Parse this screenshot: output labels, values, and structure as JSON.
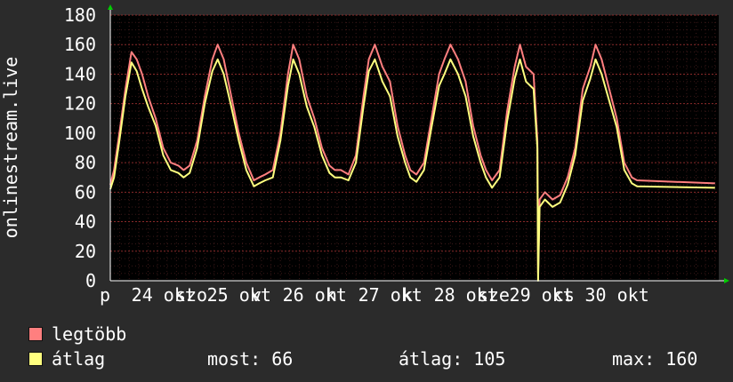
{
  "chart_data": {
    "type": "line",
    "ylabel": "onlinestream.live",
    "ylim": [
      0,
      180
    ],
    "yticks": [
      0,
      20,
      40,
      60,
      80,
      100,
      120,
      140,
      160,
      180
    ],
    "xlim": [
      0,
      8.05
    ],
    "xtick_labels": [
      {
        "x": 0.0,
        "label": "p"
      },
      {
        "x": 0.42,
        "label": "24 okt"
      },
      {
        "x": 1.0,
        "label": "szo"
      },
      {
        "x": 1.42,
        "label": "25 okt"
      },
      {
        "x": 2.0,
        "label": "v"
      },
      {
        "x": 2.42,
        "label": "26 okt"
      },
      {
        "x": 3.0,
        "label": "h"
      },
      {
        "x": 3.42,
        "label": "27 okt"
      },
      {
        "x": 4.0,
        "label": "k"
      },
      {
        "x": 4.42,
        "label": "28 okt"
      },
      {
        "x": 5.0,
        "label": "sze"
      },
      {
        "x": 5.42,
        "label": "29 okt"
      },
      {
        "x": 6.0,
        "label": "cs"
      },
      {
        "x": 6.42,
        "label": "30 okt"
      }
    ],
    "grid": true,
    "colors": {
      "max": "#ff7f7f",
      "avg": "#ffff7f",
      "background": "#000000",
      "grid": "#8a2a2a",
      "axis_arrow": "#00cc00"
    },
    "series": [
      {
        "name": "legtöbb",
        "x": [
          0,
          0.05,
          0.12,
          0.2,
          0.28,
          0.35,
          0.42,
          0.5,
          0.6,
          0.7,
          0.8,
          0.9,
          0.97,
          1.05,
          1.15,
          1.25,
          1.35,
          1.42,
          1.5,
          1.6,
          1.7,
          1.8,
          1.9,
          1.97,
          2.05,
          2.15,
          2.25,
          2.35,
          2.42,
          2.5,
          2.6,
          2.7,
          2.8,
          2.9,
          2.97,
          3.05,
          3.15,
          3.25,
          3.35,
          3.42,
          3.5,
          3.6,
          3.7,
          3.8,
          3.9,
          3.97,
          4.05,
          4.15,
          4.25,
          4.35,
          4.42,
          4.5,
          4.6,
          4.7,
          4.8,
          4.9,
          4.97,
          5.05,
          5.15,
          5.25,
          5.35,
          5.42,
          5.5,
          5.6,
          5.65,
          5.66,
          5.68,
          5.75,
          5.85,
          5.95,
          6.05,
          6.15,
          6.25,
          6.35,
          6.42,
          6.5,
          6.6,
          6.7,
          6.8,
          6.9,
          6.97,
          8.0
        ],
        "values": [
          65,
          75,
          100,
          130,
          155,
          150,
          140,
          125,
          110,
          90,
          80,
          78,
          75,
          78,
          95,
          125,
          150,
          160,
          150,
          125,
          100,
          80,
          68,
          70,
          72,
          75,
          100,
          140,
          160,
          150,
          125,
          110,
          90,
          78,
          75,
          75,
          72,
          85,
          125,
          150,
          160,
          145,
          135,
          105,
          85,
          75,
          72,
          80,
          110,
          140,
          150,
          160,
          150,
          135,
          105,
          85,
          75,
          68,
          75,
          115,
          145,
          160,
          145,
          140,
          95,
          5,
          55,
          60,
          55,
          58,
          70,
          90,
          130,
          145,
          160,
          150,
          130,
          110,
          80,
          70,
          68,
          66
        ]
      },
      {
        "name": "átlag",
        "x": [
          0,
          0.05,
          0.12,
          0.2,
          0.28,
          0.35,
          0.42,
          0.5,
          0.6,
          0.7,
          0.8,
          0.9,
          0.97,
          1.05,
          1.15,
          1.25,
          1.35,
          1.42,
          1.5,
          1.6,
          1.7,
          1.8,
          1.9,
          1.97,
          2.05,
          2.15,
          2.25,
          2.35,
          2.42,
          2.5,
          2.6,
          2.7,
          2.8,
          2.9,
          2.97,
          3.05,
          3.15,
          3.25,
          3.35,
          3.42,
          3.5,
          3.6,
          3.7,
          3.8,
          3.9,
          3.97,
          4.05,
          4.15,
          4.25,
          4.35,
          4.42,
          4.5,
          4.6,
          4.7,
          4.8,
          4.9,
          4.97,
          5.05,
          5.15,
          5.25,
          5.35,
          5.42,
          5.5,
          5.6,
          5.65,
          5.66,
          5.68,
          5.75,
          5.85,
          5.95,
          6.05,
          6.15,
          6.25,
          6.35,
          6.42,
          6.5,
          6.6,
          6.7,
          6.8,
          6.9,
          6.97,
          8.0
        ],
        "values": [
          62,
          70,
          95,
          125,
          148,
          142,
          130,
          118,
          105,
          85,
          75,
          73,
          70,
          73,
          90,
          120,
          142,
          150,
          140,
          118,
          95,
          75,
          64,
          66,
          68,
          70,
          95,
          132,
          150,
          140,
          118,
          104,
          85,
          73,
          70,
          70,
          68,
          80,
          118,
          142,
          150,
          135,
          125,
          98,
          80,
          70,
          67,
          75,
          104,
          132,
          140,
          150,
          140,
          125,
          98,
          80,
          70,
          63,
          70,
          108,
          137,
          150,
          135,
          130,
          90,
          0,
          50,
          55,
          50,
          53,
          65,
          85,
          122,
          137,
          150,
          140,
          122,
          104,
          75,
          66,
          64,
          63
        ]
      }
    ]
  },
  "legend": {
    "items": [
      {
        "label": "legtöbb",
        "color": "#ff7f7f"
      },
      {
        "label": "átlag",
        "color": "#ffff7f"
      }
    ],
    "stats": {
      "now": "most: 66",
      "avg": "átlag: 105",
      "max": "max: 160"
    }
  }
}
